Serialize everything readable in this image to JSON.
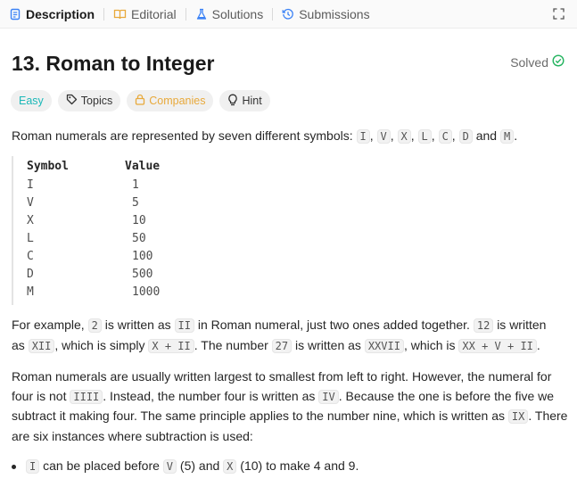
{
  "tabs": [
    {
      "label": "Description",
      "icon": "description-icon",
      "active": true
    },
    {
      "label": "Editorial",
      "icon": "book-icon"
    },
    {
      "label": "Solutions",
      "icon": "flask-icon"
    },
    {
      "label": "Submissions",
      "icon": "history-icon"
    }
  ],
  "problem": {
    "title": "13. Roman to Integer",
    "status": "Solved"
  },
  "chips": {
    "difficulty": "Easy",
    "topics": "Topics",
    "companies": "Companies",
    "hint": "Hint"
  },
  "intro": {
    "text": "Roman numerals are represented by seven different symbols:",
    "symbols": [
      "I",
      "V",
      "X",
      "L",
      "C",
      "D",
      "M"
    ],
    "and": "and",
    "period": "."
  },
  "table": {
    "headers": [
      "Symbol",
      "Value"
    ],
    "rows": [
      [
        "I",
        "1"
      ],
      [
        "V",
        "5"
      ],
      [
        "X",
        "10"
      ],
      [
        "L",
        "50"
      ],
      [
        "C",
        "100"
      ],
      [
        "D",
        "500"
      ],
      [
        "M",
        "1000"
      ]
    ]
  },
  "example": {
    "t1": "For example,",
    "c1": "2",
    "t2": "is written as",
    "c2": "II",
    "t3": "in Roman numeral, just two ones added together.",
    "c3": "12",
    "t4": "is written",
    "t5": "as",
    "c4": "XII",
    "t6": ", which is simply",
    "c5": "X + II",
    "t7": ". The number",
    "c6": "27",
    "t8": "is written as",
    "c7": "XXVII",
    "t9": ", which is",
    "c8": "XX + V + II",
    "t10": "."
  },
  "order": {
    "t1": "Roman numerals are usually written largest to smallest from left to right. However, the numeral for",
    "t2": "four is not",
    "c1": "IIII",
    "t3": ". Instead, the number four is written as",
    "c2": "IV",
    "t4": ". Because the one is before the five we",
    "t5": "subtract it making four. The same principle applies to the number nine, which is written as",
    "c3": "IX",
    "t6": ". There",
    "t7": "are six instances where subtraction is used:"
  },
  "bullets": [
    {
      "c1": "I",
      "t1": "can be placed before",
      "c2": "V",
      "t2": "(5) and",
      "c3": "X",
      "t3": "(10) to make 4 and 9."
    }
  ]
}
